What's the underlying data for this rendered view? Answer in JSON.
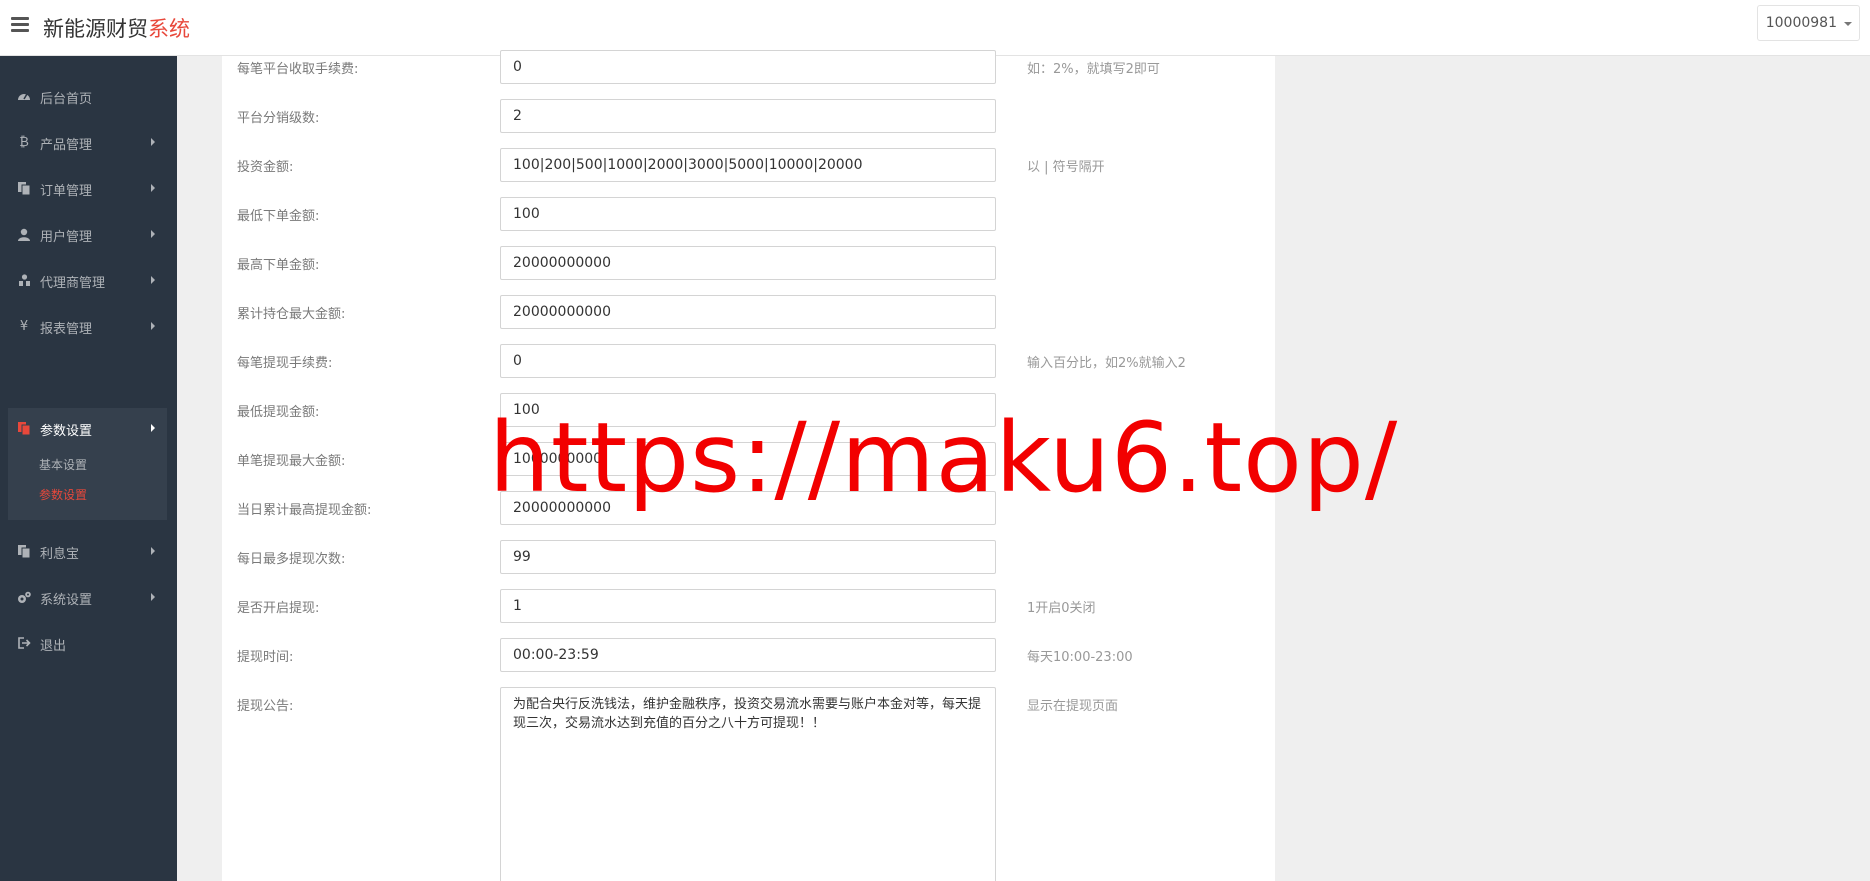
{
  "header": {
    "brand_main": "新能源财贸",
    "brand_accent": "系统",
    "user_id": "10000981"
  },
  "sidebar": {
    "items": [
      {
        "label": "后台首页",
        "icon": "dashboard-icon"
      },
      {
        "label": "产品管理",
        "icon": "bitcoin-icon"
      },
      {
        "label": "订单管理",
        "icon": "copy-icon"
      },
      {
        "label": "用户管理",
        "icon": "user-icon"
      },
      {
        "label": "代理商管理",
        "icon": "sitemap-icon"
      },
      {
        "label": "报表管理",
        "icon": "yen-icon"
      },
      {
        "label": "参数设置",
        "icon": "copy-icon"
      },
      {
        "label": "利息宝",
        "icon": "copy-icon"
      },
      {
        "label": "系统设置",
        "icon": "cogs-icon"
      },
      {
        "label": "退出",
        "icon": "sign-out-icon"
      }
    ],
    "sub_items": [
      {
        "label": "基本设置"
      },
      {
        "label": "参数设置"
      }
    ]
  },
  "form": {
    "rows": [
      {
        "label": "每笔平台收取手续费:",
        "value": "0",
        "hint": "如：2%，就填写2即可"
      },
      {
        "label": "平台分销级数:",
        "value": "2",
        "hint": ""
      },
      {
        "label": "投资金额:",
        "value": "100|200|500|1000|2000|3000|5000|10000|20000",
        "hint": "以 | 符号隔开"
      },
      {
        "label": "最低下单金额:",
        "value": "100",
        "hint": ""
      },
      {
        "label": "最高下单金额:",
        "value": "20000000000",
        "hint": ""
      },
      {
        "label": "累计持仓最大金额:",
        "value": "20000000000",
        "hint": ""
      },
      {
        "label": "每笔提现手续费:",
        "value": "0",
        "hint": "输入百分比，如2%就输入2"
      },
      {
        "label": "最低提现金额:",
        "value": "100",
        "hint": ""
      },
      {
        "label": "单笔提现最大金额:",
        "value": "1000000000",
        "hint": ""
      },
      {
        "label": "当日累计最高提现金额:",
        "value": "20000000000",
        "hint": ""
      },
      {
        "label": "每日最多提现次数:",
        "value": "99",
        "hint": ""
      },
      {
        "label": "是否开启提现:",
        "value": "1",
        "hint": "1开启0关闭"
      },
      {
        "label": "提现时间:",
        "value": "00:00-23:59",
        "hint": "每天10:00-23:00"
      }
    ],
    "notice": {
      "label": "提现公告:",
      "value": "为配合央行反洗钱法，维护金融秩序，投资交易流水需要与账户本金对等，每天提现三次，交易流水达到充值的百分之八十方可提现！！",
      "hint": "显示在提现页面"
    }
  },
  "watermark": "https://maku6.top/"
}
